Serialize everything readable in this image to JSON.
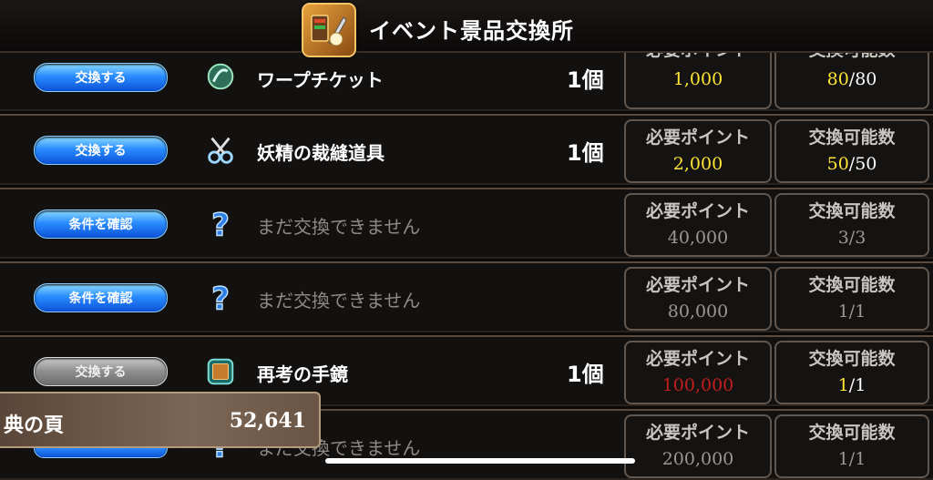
{
  "header": {
    "title": "イベント景品交換所"
  },
  "columns": {
    "need_label": "必要ポイント",
    "exchange_label": "交換可能数"
  },
  "rows": [
    {
      "button": "交換する",
      "name": "ワープチケット",
      "qty": "1個",
      "points": "1,000",
      "count": "80",
      "total": "/80"
    },
    {
      "button": "交換する",
      "name": "妖精の裁縫道具",
      "qty": "1個",
      "points": "2,000",
      "count": "50",
      "total": "/50"
    },
    {
      "button": "条件を確認",
      "name": "まだ交換できません",
      "qty": "",
      "points": "40,000",
      "count": "3/3",
      "total": ""
    },
    {
      "button": "条件を確認",
      "name": "まだ交換できません",
      "qty": "",
      "points": "80,000",
      "count": "1/1",
      "total": ""
    },
    {
      "button": "交換する",
      "name": "再考の手鏡",
      "qty": "1個",
      "points": "100,000",
      "count": "1",
      "total": "/1"
    },
    {
      "button": "",
      "name": "まだ交換できません",
      "qty": "",
      "points": "200,000",
      "count": "1/1",
      "total": ""
    }
  ],
  "points_bar": {
    "label": "典の頁",
    "value": "52,641"
  },
  "colors": {
    "accent_blue": "#2a8dff",
    "yellow": "#ffe534",
    "red": "#c21e1e"
  }
}
